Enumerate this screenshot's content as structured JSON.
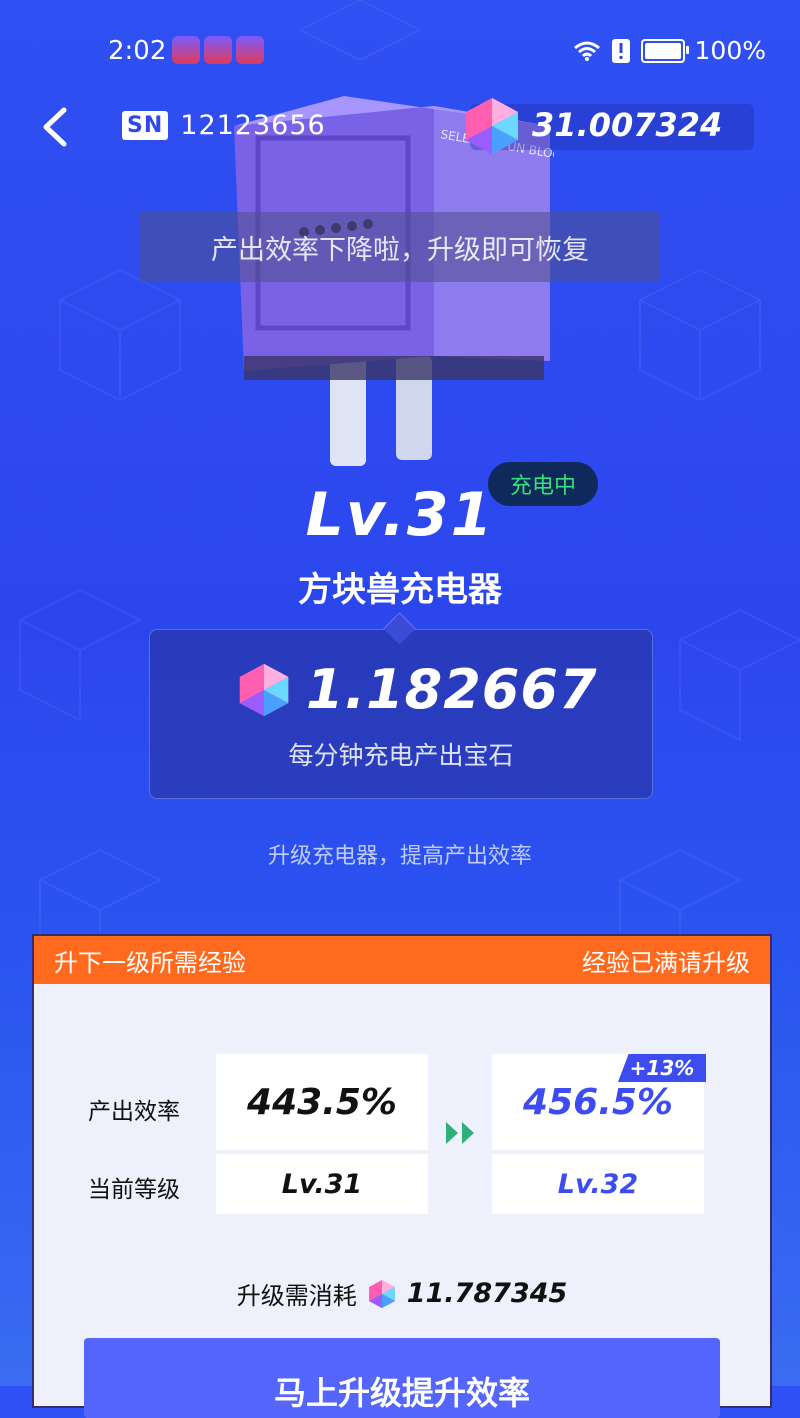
{
  "status_bar": {
    "time": "2:02",
    "battery": "100%"
  },
  "header": {
    "sn_badge": "SN",
    "sn_value": "12123656",
    "gem_balance": "31.007324"
  },
  "notice": "产出效率下降啦，升级即可恢复",
  "device": {
    "charging_status": "充电中",
    "level": "Lv.31",
    "name": "方块兽充电器",
    "rate": "1.182667",
    "rate_desc": "每分钟充电产出宝石",
    "device_text": "SELECT A FUN BLOCK TO PLAY"
  },
  "upgrade_hint": "升级充电器，提高产出效率",
  "panel": {
    "head_left": "升下一级所需经验",
    "head_right": "经验已满请升级",
    "label_efficiency": "产出效率",
    "label_level": "当前等级",
    "current_efficiency": "443.5%",
    "next_efficiency": "456.5%",
    "increase_tag": "+13%",
    "current_level": "Lv.31",
    "next_level": "Lv.32",
    "cost_label": "升级需消耗",
    "cost_value": "11.787345",
    "cta_label": "马上升级提升效率"
  },
  "colors": {
    "accent_orange": "#ff6a1f",
    "primary_blue": "#2f47ee",
    "charging_green": "#35e07a",
    "next_value_blue": "#3d4cf0"
  },
  "icons": [
    "back-arrow-icon",
    "gem-icon",
    "wifi-icon",
    "alert-icon",
    "battery-icon",
    "double-chevron-right-icon"
  ]
}
